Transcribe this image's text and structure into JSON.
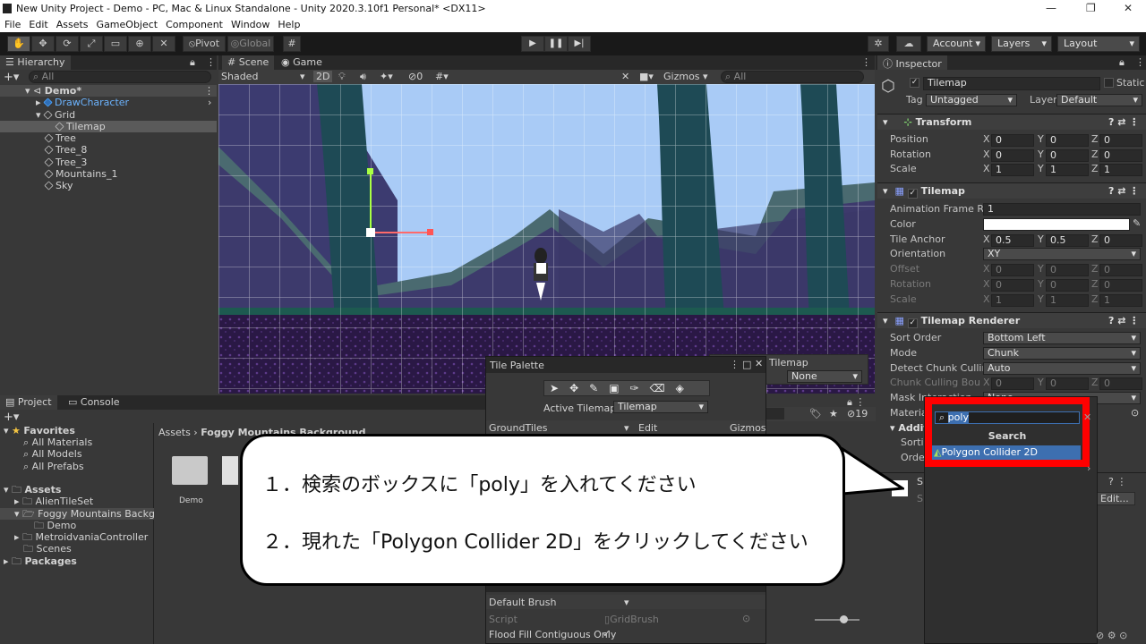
{
  "window": {
    "title": "New Unity Project - Demo - PC, Mac & Linux Standalone - Unity 2020.3.10f1 Personal* <DX11>",
    "minimize": "—",
    "maximize": "❐",
    "close": "✕"
  },
  "menu": [
    "File",
    "Edit",
    "Assets",
    "GameObject",
    "Component",
    "Window",
    "Help"
  ],
  "toolbar": {
    "pivot": "Pivot",
    "global": "Global",
    "account": "Account",
    "layers": "Layers",
    "layout": "Layout"
  },
  "hierarchy": {
    "tab": "Hierarchy",
    "search_placeholder": "All",
    "items": [
      {
        "label": "Demo*",
        "depth": 0
      },
      {
        "label": "DrawCharacter",
        "depth": 1,
        "blue": true
      },
      {
        "label": "Grid",
        "depth": 1
      },
      {
        "label": "Tilemap",
        "depth": 2,
        "selected": true
      },
      {
        "label": "Tree",
        "depth": 1
      },
      {
        "label": "Tree_8",
        "depth": 1
      },
      {
        "label": "Tree_3",
        "depth": 1
      },
      {
        "label": "Mountains_1",
        "depth": 1
      },
      {
        "label": "Sky",
        "depth": 1
      }
    ]
  },
  "scene": {
    "tabs": [
      "Scene",
      "Game"
    ],
    "shading": "Shaded",
    "mode_2d": "2D",
    "hidden_count": "0",
    "gizmos": "Gizmos",
    "search_placeholder": "All"
  },
  "tile_palette": {
    "title": "Tile Palette",
    "active_tilemap_label": "Active Tilemap",
    "active_tilemap_value": "Tilemap",
    "tiles": "GroundTiles",
    "edit": "Edit",
    "gizmos": "Gizmos",
    "brush": "Default Brush",
    "script_label": "Script",
    "script_value": "GridBrush",
    "flood_fill": "Flood Fill Contiguous Only",
    "flood_fill_check": "✓",
    "tilemap_label": "Tilemap",
    "tilemap_value": "None"
  },
  "project": {
    "tabs": [
      "Project",
      "Console"
    ],
    "favorites": {
      "label": "Favorites",
      "items": [
        "All Materials",
        "All Models",
        "All Prefabs"
      ]
    },
    "assets": {
      "label": "Assets",
      "items": [
        "AlienTileSet",
        "Foggy Mountains Backgrou",
        "Demo",
        "MetroidvaniaController",
        "Scenes"
      ]
    },
    "packages": "Packages",
    "breadcrumb": [
      "Assets",
      "Foggy Mountains Background"
    ],
    "folder_label": "Demo",
    "hidden_count": "19"
  },
  "inspector": {
    "tab": "Inspector",
    "object_name": "Tilemap",
    "static": "Static",
    "tag_label": "Tag",
    "tag_value": "Untagged",
    "layer_label": "Layer",
    "layer_value": "Default",
    "transform": {
      "title": "Transform",
      "rows": [
        {
          "label": "Position",
          "x": "0",
          "y": "0",
          "z": "0"
        },
        {
          "label": "Rotation",
          "x": "0",
          "y": "0",
          "z": "0"
        },
        {
          "label": "Scale",
          "x": "1",
          "y": "1",
          "z": "1"
        }
      ]
    },
    "tilemap": {
      "title": "Tilemap",
      "anim_label": "Animation Frame Rate",
      "anim_value": "1",
      "color_label": "Color",
      "anchor_label": "Tile Anchor",
      "anchor": {
        "x": "0.5",
        "y": "0.5",
        "z": "0"
      },
      "orientation_label": "Orientation",
      "orientation_value": "XY",
      "offset_label": "Offset",
      "offset": {
        "x": "0",
        "y": "0",
        "z": "0"
      },
      "rotation_label": "Rotation",
      "rotation": {
        "x": "0",
        "y": "0",
        "z": "0"
      },
      "scale_label": "Scale",
      "scale": {
        "x": "1",
        "y": "1",
        "z": "1"
      }
    },
    "renderer": {
      "title": "Tilemap Renderer",
      "sort_label": "Sort Order",
      "sort_value": "Bottom Left",
      "mode_label": "Mode",
      "mode_value": "Chunk",
      "detect_label": "Detect Chunk Culling",
      "detect_value": "Auto",
      "bounds_label": "Chunk Culling Bounds",
      "bounds": {
        "x": "0",
        "y": "0",
        "z": "0"
      },
      "mask_label": "Mask Interaction",
      "mask_value": "None",
      "material_label": "Material",
      "additional_label": "Additional",
      "sorting_label": "Sorting",
      "order_label": "Order"
    },
    "sprite_row": "Sp",
    "sprite_sub": "Sh",
    "edit_button": "Edit...",
    "add_component": {
      "search_value": "poly",
      "header": "Search",
      "result": "Polygon Collider 2D"
    }
  },
  "callout": {
    "step1": "１．検索のボックスに「poly」を入れてください",
    "step2": "２．現れた「Polygon Collider 2D」をクリックしてください"
  },
  "colors": {
    "highlight_border": "#ff0000",
    "selection_blue": "#3d6fb0",
    "sky": "#a9cbf6"
  }
}
